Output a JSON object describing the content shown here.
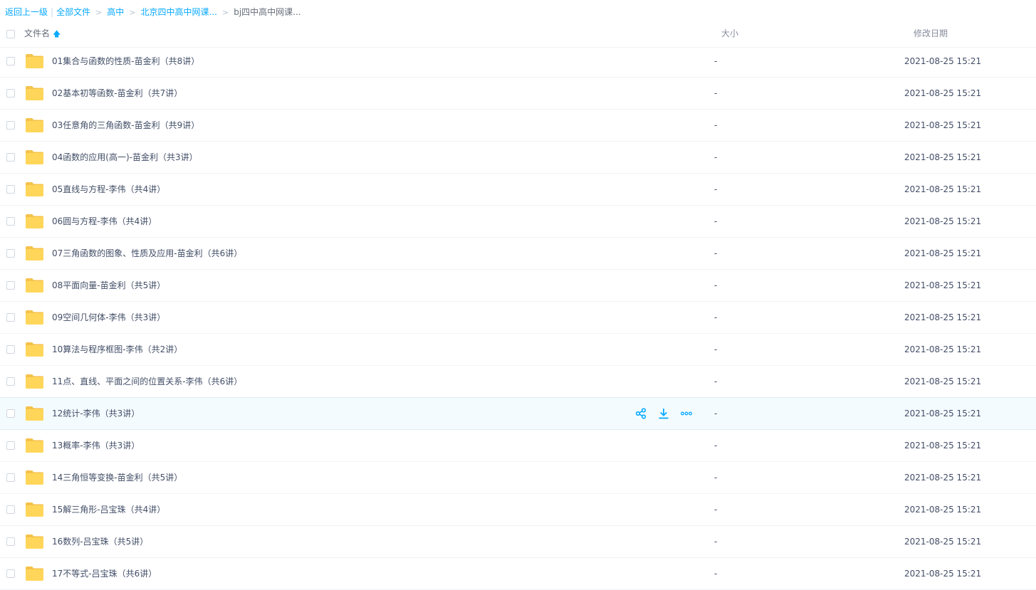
{
  "breadcrumb": {
    "back": "返回上一级",
    "all_files": "全部文件",
    "path": [
      "高中",
      "北京四中高中网课..."
    ],
    "current": "bj四中高中网课..."
  },
  "header": {
    "name": "文件名",
    "size": "大小",
    "date": "修改日期"
  },
  "colors": {
    "accent": "#09aaff",
    "folder": "#ffd659",
    "hover_row": "#f4fbff"
  },
  "hover_actions": [
    "share-icon",
    "download-icon",
    "more-icon"
  ],
  "files": [
    {
      "name": "01集合与函数的性质-苗金利（共8讲）",
      "size": "-",
      "date": "2021-08-25 15:21"
    },
    {
      "name": "02基本初等函数-苗金利（共7讲）",
      "size": "-",
      "date": "2021-08-25 15:21"
    },
    {
      "name": "03任意角的三角函数-苗金利（共9讲）",
      "size": "-",
      "date": "2021-08-25 15:21"
    },
    {
      "name": "04函数的应用(高一)-苗金利（共3讲）",
      "size": "-",
      "date": "2021-08-25 15:21"
    },
    {
      "name": "05直线与方程-李伟（共4讲）",
      "size": "-",
      "date": "2021-08-25 15:21"
    },
    {
      "name": "06圆与方程-李伟（共4讲）",
      "size": "-",
      "date": "2021-08-25 15:21"
    },
    {
      "name": "07三角函数的图象、性质及应用-苗金利（共6讲）",
      "size": "-",
      "date": "2021-08-25 15:21"
    },
    {
      "name": "08平面向量-苗金利（共5讲）",
      "size": "-",
      "date": "2021-08-25 15:21"
    },
    {
      "name": "09空间几何体-李伟（共3讲）",
      "size": "-",
      "date": "2021-08-25 15:21"
    },
    {
      "name": "10算法与程序框图-李伟（共2讲）",
      "size": "-",
      "date": "2021-08-25 15:21"
    },
    {
      "name": "11点、直线、平面之间的位置关系-李伟（共6讲）",
      "size": "-",
      "date": "2021-08-25 15:21"
    },
    {
      "name": "12统计-李伟（共3讲）",
      "size": "-",
      "date": "2021-08-25 15:21"
    },
    {
      "name": "13概率-李伟（共3讲）",
      "size": "-",
      "date": "2021-08-25 15:21"
    },
    {
      "name": "14三角恒等变换-苗金利（共5讲）",
      "size": "-",
      "date": "2021-08-25 15:21"
    },
    {
      "name": "15解三角形-吕宝珠（共4讲）",
      "size": "-",
      "date": "2021-08-25 15:21"
    },
    {
      "name": "16数列-吕宝珠（共5讲）",
      "size": "-",
      "date": "2021-08-25 15:21"
    },
    {
      "name": "17不等式-吕宝珠（共6讲）",
      "size": "-",
      "date": "2021-08-25 15:21"
    }
  ]
}
